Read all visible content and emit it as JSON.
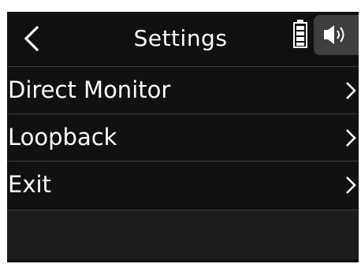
{
  "header": {
    "title": "Settings",
    "back_icon": "chevron-left-icon",
    "battery_icon": "battery-icon",
    "speaker_icon": "speaker-icon"
  },
  "menu": {
    "items": [
      {
        "label": "Direct Monitor",
        "icon": "chevron-right-icon"
      },
      {
        "label": "Loopback",
        "icon": "chevron-right-icon"
      },
      {
        "label": "Exit",
        "icon": "chevron-right-icon"
      }
    ]
  },
  "colors": {
    "screen_background": "#101010",
    "speaker_box": "#3f3f3f",
    "divider": "#3a3a3a",
    "text": "#ffffff"
  }
}
